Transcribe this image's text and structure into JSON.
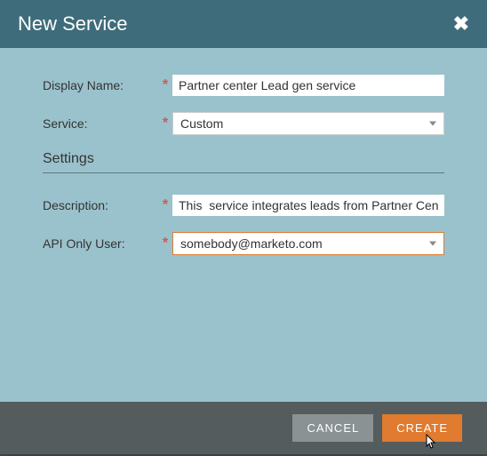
{
  "dialog": {
    "title": "New Service",
    "close_label": "✖"
  },
  "form": {
    "display_name": {
      "label": "Display Name:",
      "required": "*",
      "value": "Partner center Lead gen service"
    },
    "service": {
      "label": "Service:",
      "required": "*",
      "value": "Custom"
    },
    "section_heading": "Settings",
    "description": {
      "label": "Description:",
      "required": "*",
      "value": "This  service integrates leads from Partner Center"
    },
    "api_only_user": {
      "label": "API Only User:",
      "required": "*",
      "value": "somebody@marketo.com"
    }
  },
  "buttons": {
    "cancel": "CANCEL",
    "create": "CREATE"
  }
}
